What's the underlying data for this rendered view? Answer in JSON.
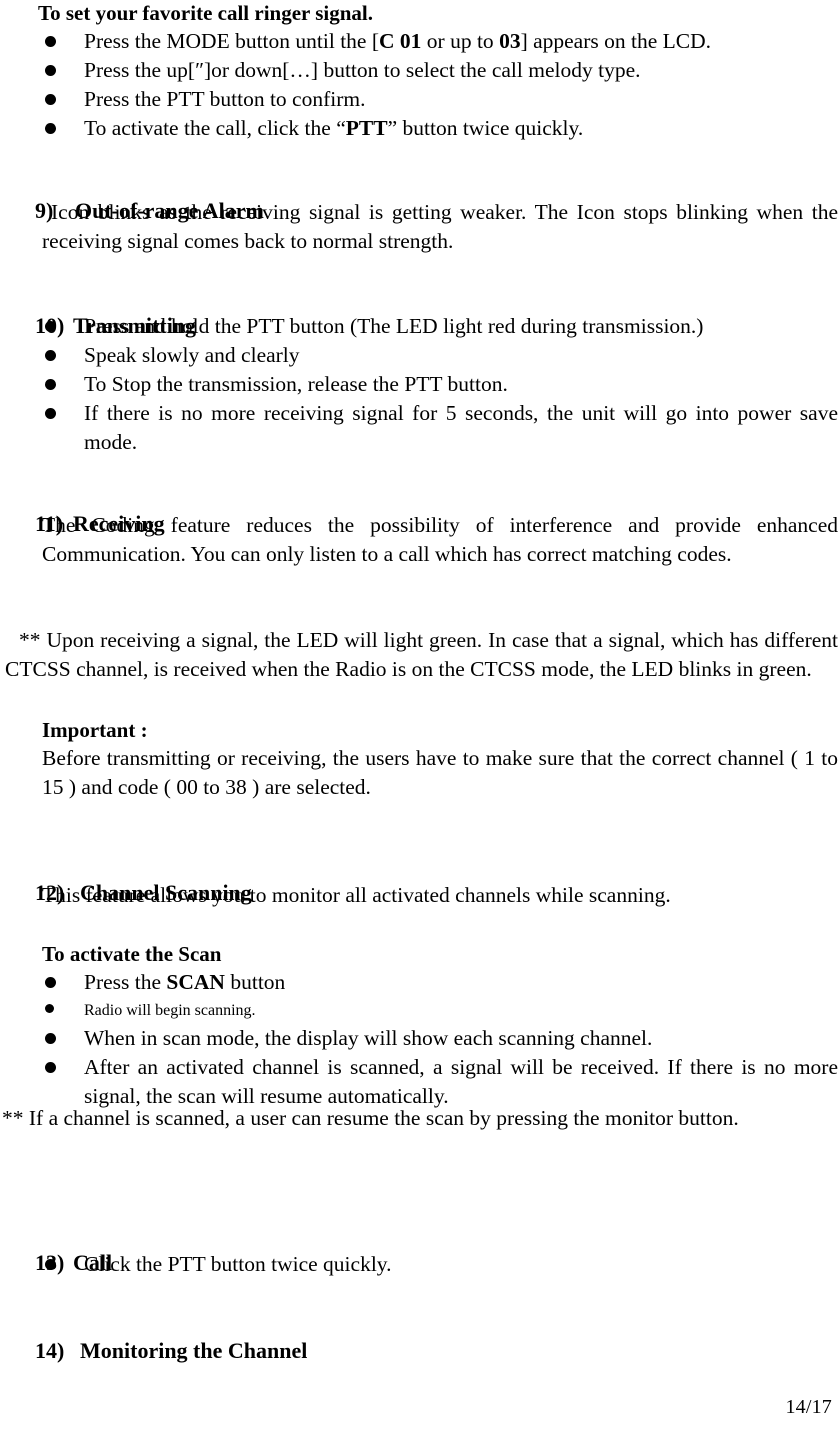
{
  "document": {
    "type": "two-way-radio-user-manual-page",
    "page_label": "14/17"
  },
  "section_ringer": {
    "heading": "To set your favorite call ringer signal.",
    "bullets": [
      {
        "pre": "Press the MODE button until the [",
        "bold1": "C 01",
        "mid": " or up to ",
        "bold2": "03",
        "post": "] appears on the LCD."
      },
      {
        "text": "Press the up[″]or down[…] button to select the call melody type."
      },
      {
        "text": "Press the PTT button to confirm."
      },
      {
        "pre": "To activate the call, click the “",
        "bold1": "PTT",
        "post": "” button twice quickly."
      }
    ]
  },
  "section_9": {
    "number": "9)",
    "title": "Out-of-range Alarm",
    "body": "Icon blinks as the receiving signal is getting weaker. The Icon stops blinking when the receiving signal comes back to normal strength."
  },
  "section_10": {
    "number": "10)",
    "title": "Transmitting",
    "bullets": [
      "Press and hold the PTT button (The LED light red during transmission.)",
      "Speak slowly and clearly",
      "To Stop the transmission, release the PTT button.",
      "If there is no more receiving signal for 5 seconds, the unit will go into power save mode."
    ]
  },
  "section_11": {
    "number": "11)",
    "title": "Receiving",
    "body": "The Coding feature reduces the possibility of interference and provide enhanced Communication. You can only listen to a call which has correct matching codes.",
    "note": "** Upon receiving a signal, the LED will light green. In case that a signal, which has different CTCSS channel, is received when the Radio is on the CTCSS mode, the LED blinks in green.",
    "important_label": "Important :",
    "important_body": "Before transmitting or receiving, the users have to make sure that the correct channel ( 1 to 15 ) and code ( 00 to 38 ) are selected."
  },
  "section_12": {
    "number": "12)",
    "title": "Channel Scanning",
    "body": "This feature allows you to monitor all activated channels while scanning.",
    "sub_heading": "To activate the Scan",
    "bullets": [
      {
        "pre": "Press the ",
        "bold1": "SCAN",
        "post": " button",
        "small": false
      },
      {
        "text": "Radio will begin scanning.",
        "small": true
      },
      {
        "text": "When in scan mode, the display will show each scanning channel.",
        "small": false
      },
      {
        "text": "After an activated channel is scanned, a signal will be received. If there is no more signal, the scan will resume automatically.",
        "small": false
      }
    ],
    "note": "** If a channel is scanned, a user can resume the scan by pressing the monitor button."
  },
  "section_13": {
    "number": "13)",
    "title": "Call",
    "bullets": [
      "Click the PTT button twice quickly."
    ]
  },
  "section_14": {
    "number": "14)",
    "title": "Monitoring the Channel"
  }
}
